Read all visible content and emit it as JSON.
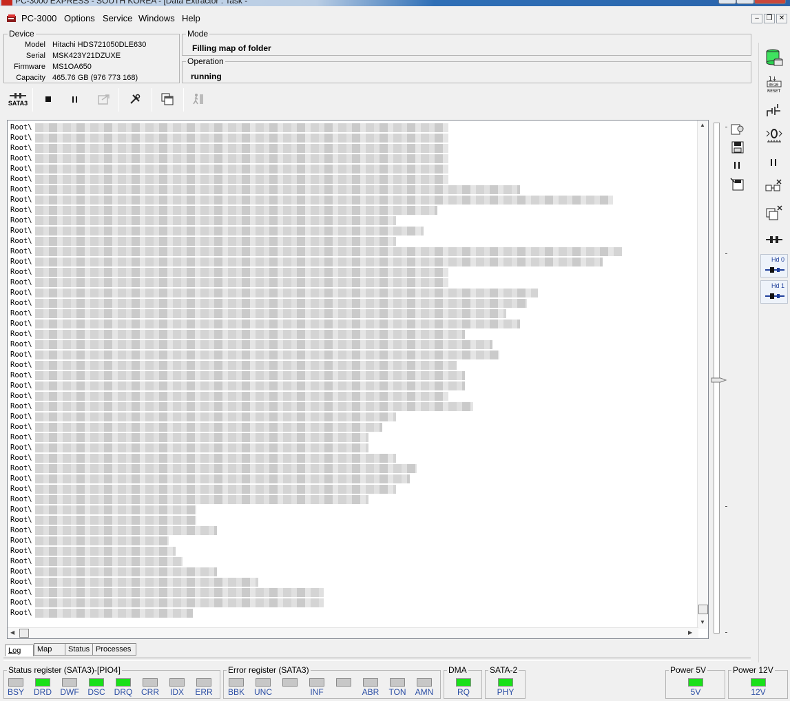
{
  "window": {
    "title": "PC-3000 EXPRESS - SOUTH KOREA - [Data Extractor : Task -"
  },
  "menu": [
    "PC-3000",
    "Options",
    "Service",
    "Windows",
    "Help"
  ],
  "device": {
    "legend": "Device",
    "rows": [
      {
        "label": "Model",
        "value": "Hitachi HDS721050DLE630"
      },
      {
        "label": "Serial",
        "value": "MSK423Y21DZUXE"
      },
      {
        "label": "Firmware",
        "value": "MS1OA650"
      },
      {
        "label": "Capacity",
        "value": "465.76 GB (976 773 168)"
      }
    ]
  },
  "mode": {
    "legend": "Mode",
    "value": "Filling map of folder"
  },
  "operation": {
    "legend": "Operation",
    "value": "running"
  },
  "toolbar": {
    "port_label": "SATA3"
  },
  "log": {
    "prefix": "Root\\",
    "line_count": 48
  },
  "tabs": [
    {
      "label": "Log",
      "active": true
    },
    {
      "label": "Map",
      "active": false
    },
    {
      "label": "Status",
      "active": false
    },
    {
      "label": "Processes",
      "active": false
    }
  ],
  "right_panel": {
    "hd0": "Hd 0",
    "hd1": "Hd 1"
  },
  "status_register": {
    "legend": "Status register (SATA3)-[PIO4]",
    "leds": [
      {
        "label": "BSY",
        "state": "off"
      },
      {
        "label": "DRD",
        "state": "on"
      },
      {
        "label": "DWF",
        "state": "off"
      },
      {
        "label": "DSC",
        "state": "on"
      },
      {
        "label": "DRQ",
        "state": "on"
      },
      {
        "label": "CRR",
        "state": "off"
      },
      {
        "label": "IDX",
        "state": "off"
      },
      {
        "label": "ERR",
        "state": "off"
      }
    ]
  },
  "error_register": {
    "legend": "Error register (SATA3)",
    "leds": [
      {
        "label": "BBK",
        "state": "off"
      },
      {
        "label": "UNC",
        "state": "off"
      },
      {
        "label": "",
        "state": "off"
      },
      {
        "label": "INF",
        "state": "off"
      },
      {
        "label": "",
        "state": "off"
      },
      {
        "label": "ABR",
        "state": "off"
      },
      {
        "label": "TON",
        "state": "off"
      },
      {
        "label": "AMN",
        "state": "off"
      }
    ]
  },
  "dma": {
    "legend": "DMA",
    "label": "RQ",
    "state": "on"
  },
  "sata2": {
    "legend": "SATA-2",
    "label": "PHY",
    "state": "on"
  },
  "power5": {
    "legend": "Power 5V",
    "label": "5V",
    "state": "on"
  },
  "power12": {
    "legend": "Power 12V",
    "label": "12V",
    "state": "on"
  },
  "colors": {
    "led_on": "#19e019",
    "led_off": "#c7c7c7",
    "label_blue": "#2c4fa5"
  }
}
